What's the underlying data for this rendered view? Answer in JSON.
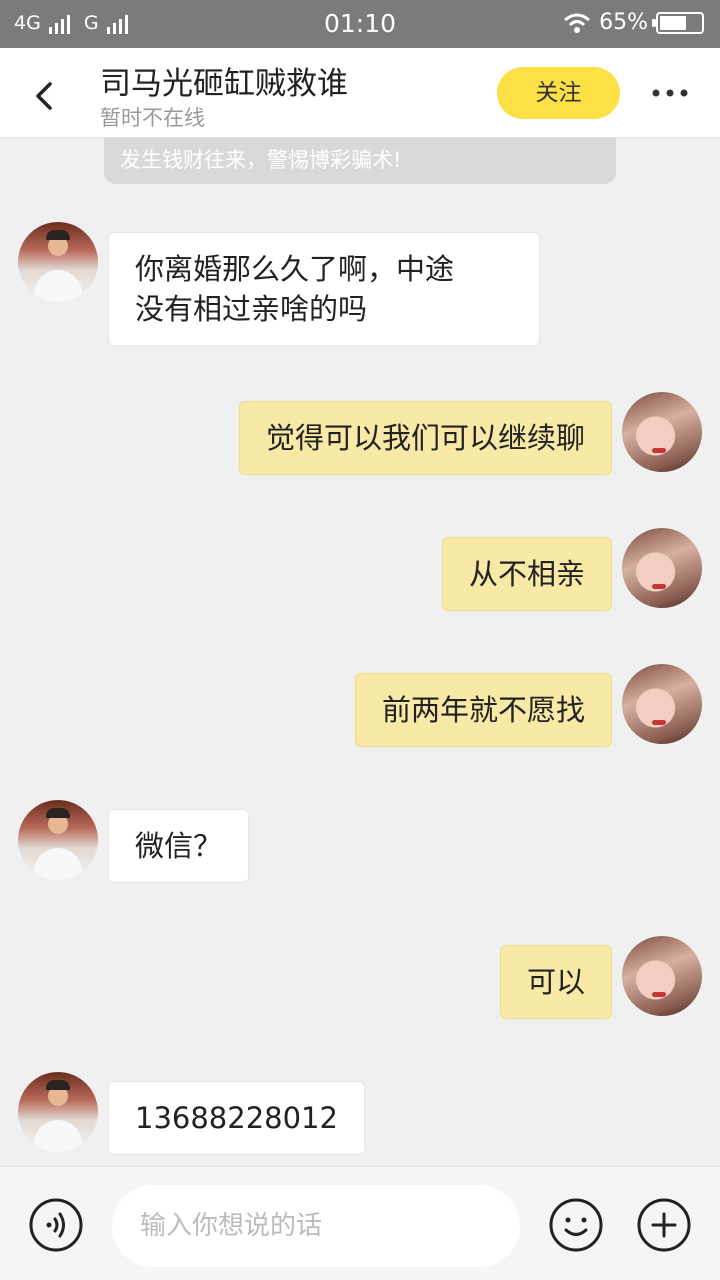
{
  "status_bar": {
    "network1": "4G",
    "network2": "G",
    "time": "01:10",
    "battery": "65%",
    "battery_level": 0.65
  },
  "header": {
    "title": "司马光砸缸贼救谁",
    "subtitle": "暂时不在线",
    "follow_label": "关注"
  },
  "notice": "发生钱财往来，警惕博彩骗术!",
  "messages": [
    {
      "side": "in",
      "text_lines": [
        "你离婚那么久了啊，中途",
        "没有相过亲啥的吗"
      ]
    },
    {
      "side": "out",
      "text": "觉得可以我们可以继续聊"
    },
    {
      "side": "out",
      "text": "从不相亲"
    },
    {
      "side": "out",
      "text": "前两年就不愿找"
    },
    {
      "side": "in",
      "text": "微信？"
    },
    {
      "side": "out",
      "text": "可以"
    },
    {
      "side": "in",
      "text": "13688228012"
    }
  ],
  "input": {
    "placeholder": "输入你想说的话"
  },
  "icons": {
    "back": "chevron-left-icon",
    "more": "more-dots-icon",
    "voice": "voice-icon",
    "emoji": "emoji-icon",
    "plus": "plus-icon"
  },
  "colors": {
    "accent": "#fde046",
    "outgoing_bubble": "#f9e9a6",
    "incoming_bubble": "#ffffff",
    "status_bar": "#7b7b7b",
    "background": "#f0f0f0"
  }
}
